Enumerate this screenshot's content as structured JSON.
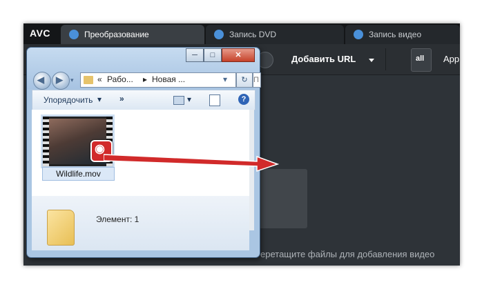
{
  "app": {
    "logo": "AVC",
    "tabs": [
      {
        "label": "Преобразование",
        "icon": "refresh-icon",
        "active": true
      },
      {
        "label": "Запись DVD",
        "icon": "disc-icon",
        "active": false
      },
      {
        "label": "Запись видео",
        "icon": "play-icon",
        "active": false
      }
    ],
    "toolbar": {
      "add_url_label": "Добавить URL",
      "apps_label": "App",
      "apps_icon_text": "all"
    },
    "drop_hint": "еретащите файлы для добавления видео"
  },
  "explorer": {
    "caption_buttons": {
      "minimize": "─",
      "maximize": "□",
      "close": "✕"
    },
    "back_symbol": "◀",
    "forward_symbol": "▶",
    "address_parts": [
      "«",
      "Рабо...",
      "▸",
      "Новая ..."
    ],
    "address_dropdown": "▾",
    "refresh_symbol": "↻",
    "search_stub": "П",
    "commands": {
      "organize": "Упорядочить",
      "organize_arrow": "▾",
      "more": "»",
      "view_arrow": "▾",
      "help": "?"
    },
    "file": {
      "name": "Wildlife.mov"
    },
    "details": {
      "count_text": "Элемент: 1"
    }
  },
  "colors": {
    "app_bg": "#2e3338",
    "tabbar_bg": "#141618",
    "arrow": "#d12a2a",
    "explorer_frame": "#aac6e3"
  }
}
